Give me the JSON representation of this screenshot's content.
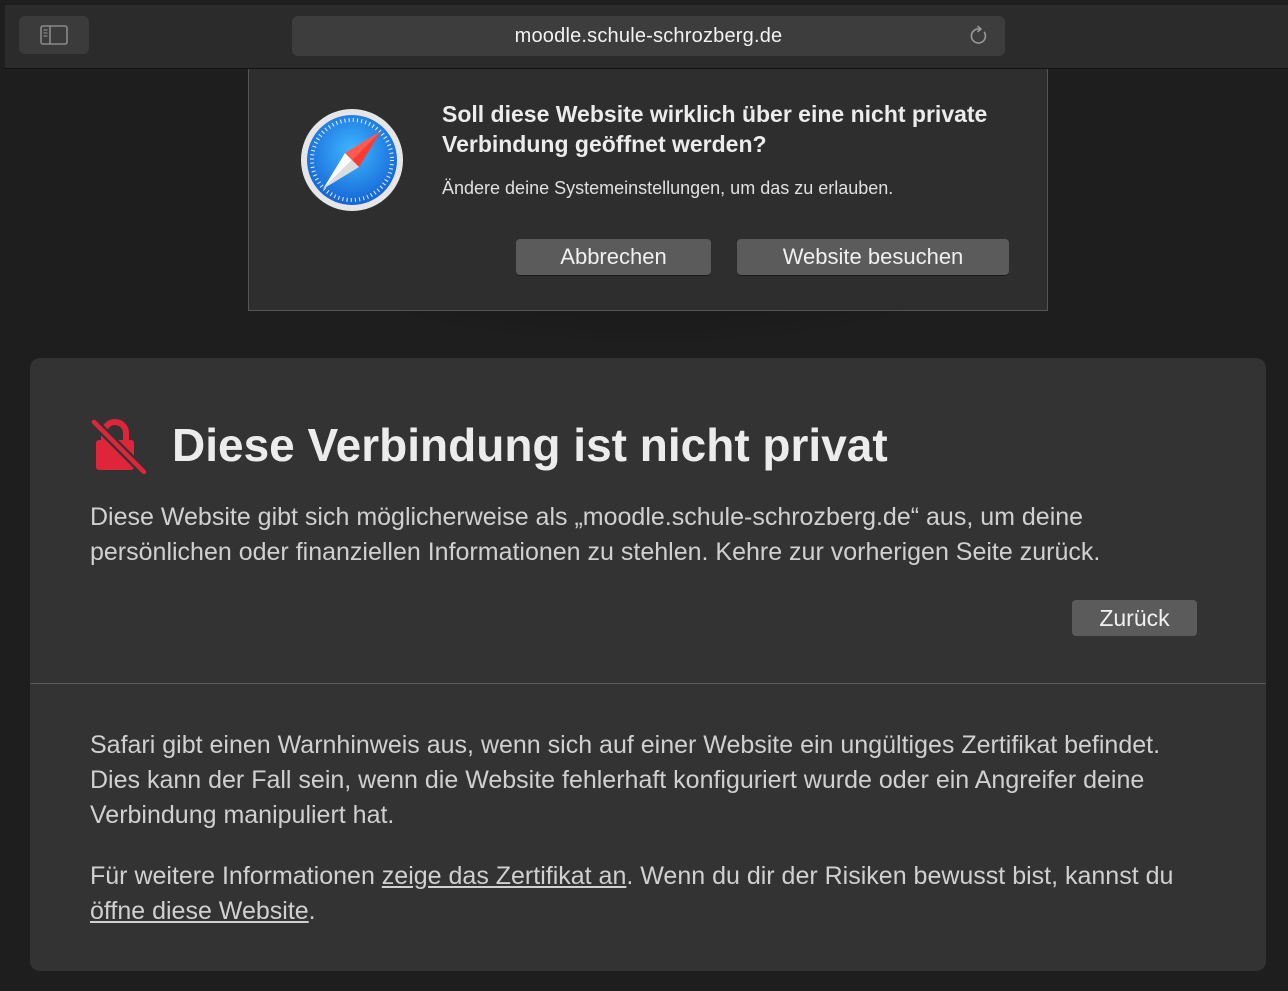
{
  "toolbar": {
    "url": "moodle.schule-schrozberg.de",
    "sidebar_icon": "sidebar-icon",
    "reload_icon": "reload-icon"
  },
  "dialog": {
    "icon": "safari-compass-icon",
    "title": "Soll diese Website wirklich über eine nicht private Verbindung geöffnet werden?",
    "message": "Ändere deine Systemeinstellungen, um das zu erlauben.",
    "cancel_label": "Abbrechen",
    "visit_label": "Website besuchen"
  },
  "warning": {
    "icon": "broken-lock-icon",
    "icon_color": "#e0243a",
    "title": "Diese Verbindung ist nicht privat",
    "description": "Diese Website gibt sich möglicherweise als „moodle.schule-schrozberg.de“ aus, um deine persönlichen oder finanziellen Informationen zu stehlen. Kehre zur vorherigen Seite zurück.",
    "back_label": "Zurück",
    "info_paragraph": "Safari gibt einen Warnhinweis aus, wenn sich auf einer Website ein ungültiges Zertifikat befindet. Dies kann der Fall sein, wenn die Website fehlerhaft konfiguriert wurde oder ein Angreifer deine Verbindung manipuliert hat.",
    "more_info_prefix": "Für weitere Informationen ",
    "show_cert_link": "zeige das Zertifikat an",
    "more_info_middle": ". Wenn du dir der Risiken bewusst bist, kannst du ",
    "open_site_link": "öffne diese Website",
    "more_info_suffix": "."
  }
}
